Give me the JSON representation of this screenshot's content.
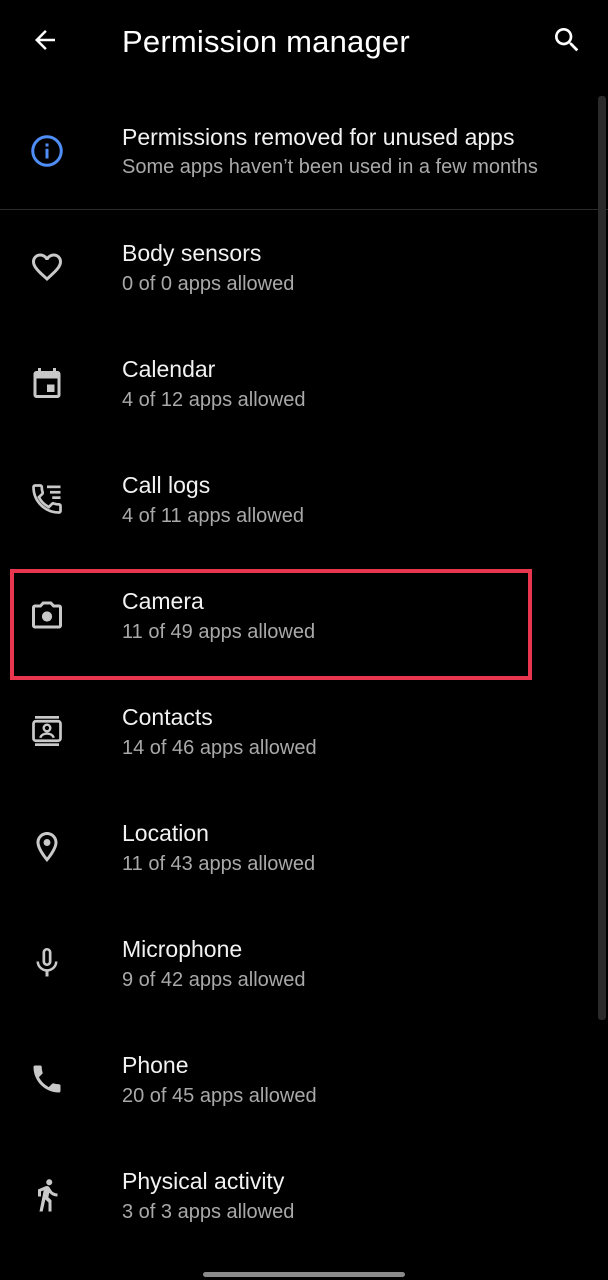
{
  "header": {
    "title": "Permission manager"
  },
  "notice": {
    "title": "Permissions removed for unused apps",
    "subtitle": "Some apps haven’t been used in a few months",
    "accent": "#4f8ef7"
  },
  "permissions": [
    {
      "icon": "heart-icon",
      "title": "Body sensors",
      "subtitle": "0 of 0 apps allowed"
    },
    {
      "icon": "calendar-icon",
      "title": "Calendar",
      "subtitle": "4 of 12 apps allowed"
    },
    {
      "icon": "call-log-icon",
      "title": "Call logs",
      "subtitle": "4 of 11 apps allowed"
    },
    {
      "icon": "camera-icon",
      "title": "Camera",
      "subtitle": "11 of 49 apps allowed"
    },
    {
      "icon": "contacts-icon",
      "title": "Contacts",
      "subtitle": "14 of 46 apps allowed"
    },
    {
      "icon": "location-pin-icon",
      "title": "Location",
      "subtitle": "11 of 43 apps allowed"
    },
    {
      "icon": "microphone-icon",
      "title": "Microphone",
      "subtitle": "9 of 42 apps allowed"
    },
    {
      "icon": "phone-icon",
      "title": "Phone",
      "subtitle": "20 of 45 apps allowed"
    },
    {
      "icon": "walking-person-icon",
      "title": "Physical activity",
      "subtitle": "3 of 3 apps allowed"
    }
  ],
  "highlight": {
    "item": "Camera",
    "color": "#e8364f"
  },
  "colors": {
    "background": "#000000",
    "text_primary": "#f2f2f2",
    "text_secondary": "#a9a9a9"
  }
}
